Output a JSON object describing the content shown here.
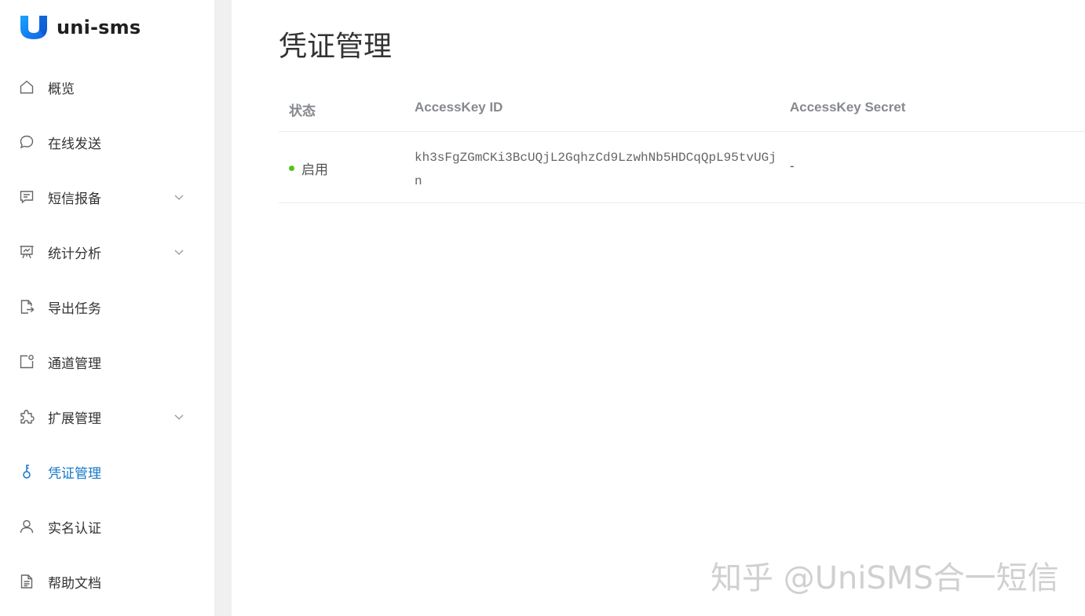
{
  "app": {
    "logo_text": "uni-sms",
    "brand_color": "#1677ff"
  },
  "sidebar": {
    "items": [
      {
        "label": "概览",
        "icon": "home-icon",
        "has_submenu": false,
        "active": false
      },
      {
        "label": "在线发送",
        "icon": "chat-bubble-icon",
        "has_submenu": false,
        "active": false
      },
      {
        "label": "短信报备",
        "icon": "message-report-icon",
        "has_submenu": true,
        "active": false
      },
      {
        "label": "统计分析",
        "icon": "presentation-chart-icon",
        "has_submenu": true,
        "active": false
      },
      {
        "label": "导出任务",
        "icon": "file-export-icon",
        "has_submenu": false,
        "active": false
      },
      {
        "label": "通道管理",
        "icon": "channel-icon",
        "has_submenu": false,
        "active": false
      },
      {
        "label": "扩展管理",
        "icon": "puzzle-icon",
        "has_submenu": true,
        "active": false
      },
      {
        "label": "凭证管理",
        "icon": "key-icon",
        "has_submenu": false,
        "active": true
      },
      {
        "label": "实名认证",
        "icon": "user-icon",
        "has_submenu": false,
        "active": false
      },
      {
        "label": "帮助文档",
        "icon": "document-icon",
        "has_submenu": false,
        "active": false
      }
    ],
    "active_color": "#1677c8"
  },
  "main": {
    "title": "凭证管理",
    "table": {
      "columns": [
        "状态",
        "AccessKey ID",
        "AccessKey Secret"
      ],
      "rows": [
        {
          "status": "启用",
          "status_color": "#52c41a",
          "access_key_id": "kh3sFgZGmCKi3BcUQjL2GqhzCd9LzwhNb5HDCqQpL95tvUGjn",
          "access_key_secret": "-"
        }
      ]
    }
  },
  "watermark": "知乎 @UniSMS合一短信"
}
